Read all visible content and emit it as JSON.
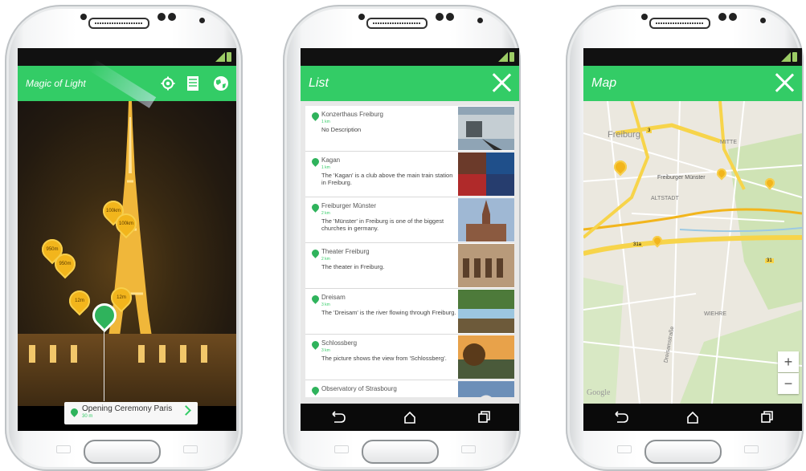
{
  "phones": {
    "ar": {
      "app_title": "Magic of Light",
      "toolbar_icons": [
        "settings-icon",
        "list-icon",
        "globe-icon"
      ],
      "markers": [
        "100km",
        "100km",
        "950m",
        "950m",
        "12m",
        "12m"
      ],
      "poi_card": {
        "title": "Opening Ceremony Paris",
        "distance": "30 m"
      }
    },
    "list": {
      "title": "List",
      "items": [
        {
          "name": "Konzerthaus Freiburg",
          "distance": "1 km",
          "description": "No Description"
        },
        {
          "name": "Kagan",
          "distance": "1 km",
          "description": "The 'Kagan' is a club above the main train station in Freiburg."
        },
        {
          "name": "Freiburger Münster",
          "distance": "2 km",
          "description": "The 'Münster' in Freiburg is one of the biggest churches in germany."
        },
        {
          "name": "Theater Freiburg",
          "distance": "2 km",
          "description": "The theater in Freiburg."
        },
        {
          "name": "Dreisam",
          "distance": "3 km",
          "description": "The 'Dreisam' is the river flowing through Freiburg."
        },
        {
          "name": "Schlossberg",
          "distance": "3 km",
          "description": "The picture shows the view from 'Schlossberg'."
        },
        {
          "name": "Observatory of Strasbourg",
          "distance": "",
          "description": ""
        }
      ]
    },
    "map": {
      "title": "Map",
      "zoom_in": "+",
      "zoom_out": "−",
      "watermark": "Google",
      "labels": [
        "Freiburg",
        "MITTE",
        "Freiburger Münster",
        "ALTSTADT",
        "WIEHRE",
        "Dreisamstraße"
      ],
      "road_shields": [
        "3",
        "31a",
        "31"
      ]
    }
  },
  "colors": {
    "accent": "#33cc66",
    "marker": "#f2b51c"
  }
}
